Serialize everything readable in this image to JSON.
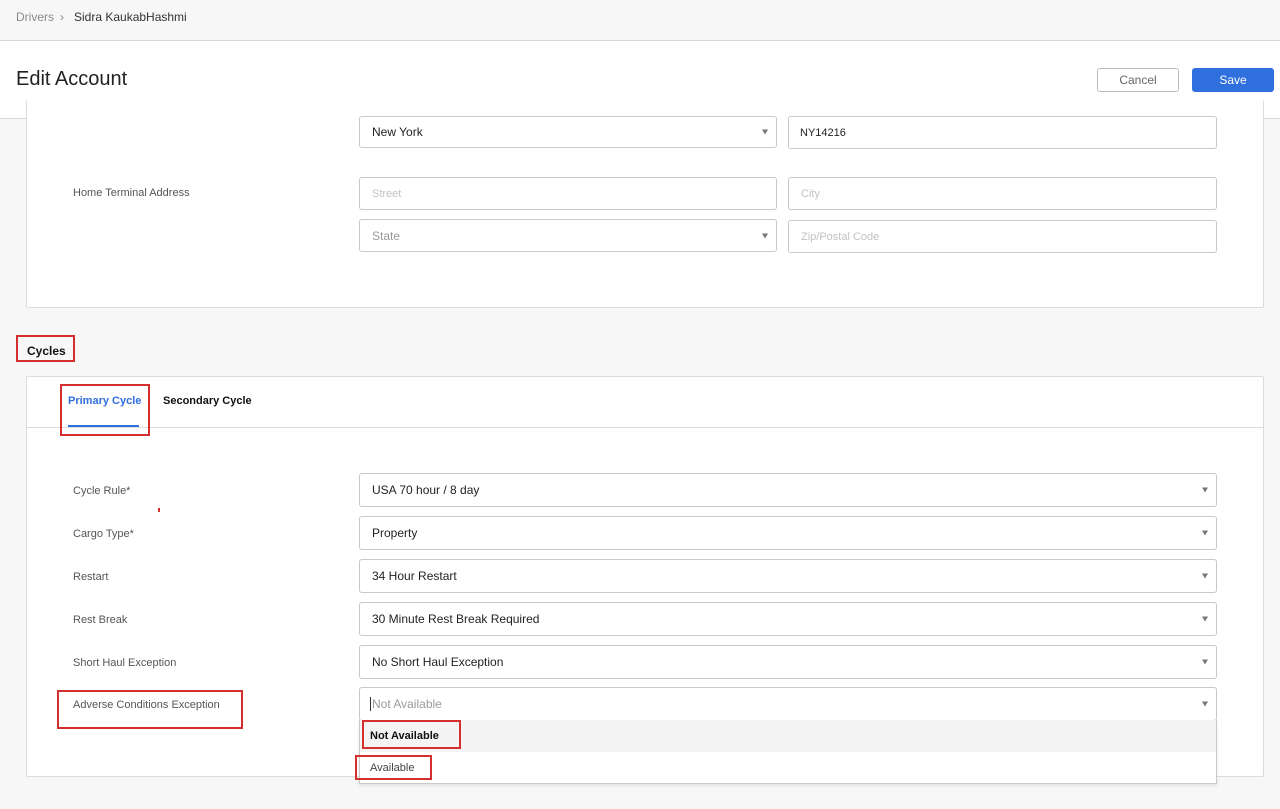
{
  "breadcrumb": {
    "root": "Drivers",
    "separator": "›",
    "current": "Sidra KaukabHashmi"
  },
  "header": {
    "title": "Edit Account",
    "cancel_label": "Cancel",
    "save_label": "Save"
  },
  "address": {
    "state_value": "New York",
    "license_value": "NY14216",
    "home_terminal_label": "Home Terminal Address",
    "street_placeholder": "Street",
    "city_placeholder": "City",
    "state_placeholder": "State",
    "zip_placeholder": "Zip/Postal Code"
  },
  "cycles": {
    "section_title": "Cycles",
    "tabs": [
      {
        "label": "Primary Cycle",
        "active": true
      },
      {
        "label": "Secondary Cycle",
        "active": false
      }
    ],
    "fields": [
      {
        "label": "Cycle Rule*",
        "value": "USA 70 hour / 8 day"
      },
      {
        "label": "Cargo Type*",
        "value": "Property"
      },
      {
        "label": "Restart",
        "value": "34 Hour Restart"
      },
      {
        "label": "Rest Break",
        "value": "30 Minute Rest Break Required"
      },
      {
        "label": "Short Haul Exception",
        "value": "No Short Haul Exception"
      }
    ],
    "adverse": {
      "label": "Adverse Conditions Exception",
      "placeholder": "Not Available",
      "options": [
        "Not Available",
        "Available"
      ]
    }
  },
  "colors": {
    "accent": "#2f6fde",
    "highlight": "#d32f2f"
  }
}
